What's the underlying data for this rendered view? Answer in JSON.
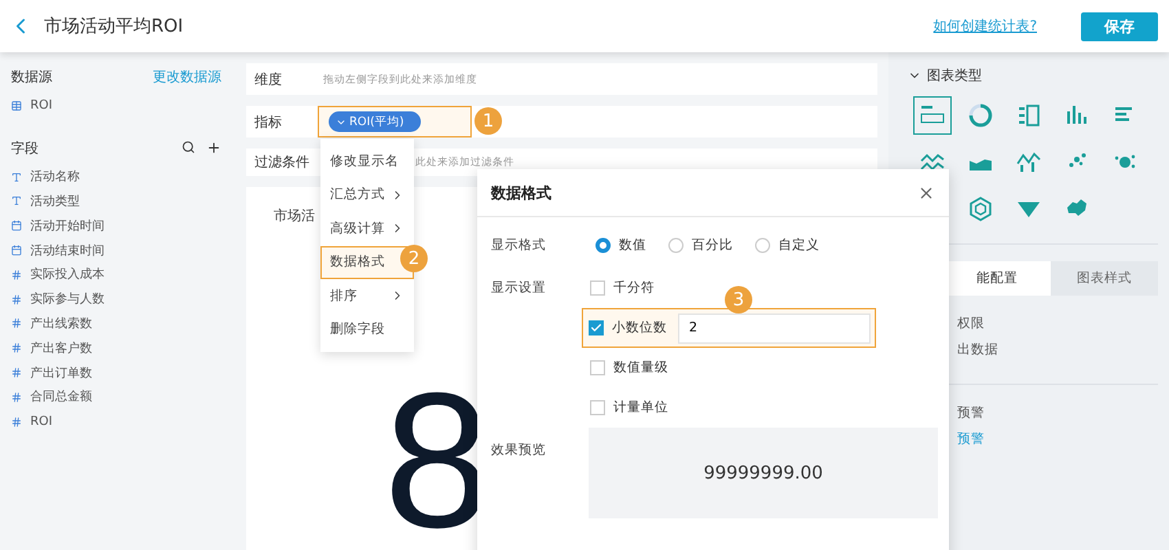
{
  "header": {
    "title": "市场活动平均ROI",
    "help_link": "如何创建统计表?",
    "save_button": "保存"
  },
  "sidebar": {
    "datasource_label": "数据源",
    "change_link": "更改数据源",
    "datasource": "ROI",
    "fields_label": "字段",
    "fields": [
      {
        "name": "活动名称",
        "kind": "text"
      },
      {
        "name": "活动类型",
        "kind": "text"
      },
      {
        "name": "活动开始时间",
        "kind": "date"
      },
      {
        "name": "活动结束时间",
        "kind": "date"
      },
      {
        "name": "实际投入成本",
        "kind": "number"
      },
      {
        "name": "实际参与人数",
        "kind": "number"
      },
      {
        "name": "产出线索数",
        "kind": "number"
      },
      {
        "name": "产出客户数",
        "kind": "number"
      },
      {
        "name": "产出订单数",
        "kind": "number"
      },
      {
        "name": "合同总金额",
        "kind": "number"
      },
      {
        "name": "ROI",
        "kind": "number"
      }
    ]
  },
  "builder": {
    "dimension": {
      "label": "维度",
      "placeholder": "拖动左侧字段到此处来添加维度"
    },
    "measure": {
      "label": "指标",
      "pill": "ROI(平均)",
      "highlighted": true,
      "step": "1"
    },
    "filter": {
      "label": "过滤条件",
      "placeholder": "此处来添加过滤条件"
    }
  },
  "card": {
    "title": "市场活",
    "value": "8"
  },
  "context_menu": {
    "step": "2",
    "items": [
      {
        "label": "修改显示名",
        "submenu": false,
        "highlighted": false
      },
      {
        "label": "汇总方式",
        "submenu": true,
        "highlighted": false
      },
      {
        "label": "高级计算",
        "submenu": true,
        "highlighted": false
      },
      {
        "label": "数据格式",
        "submenu": false,
        "highlighted": true
      },
      {
        "label": "排序",
        "submenu": true,
        "highlighted": false
      },
      {
        "label": "删除字段",
        "submenu": false,
        "highlighted": false
      }
    ]
  },
  "dialog": {
    "title": "数据格式",
    "format_label": "显示格式",
    "formats": [
      {
        "label": "数值",
        "selected": true
      },
      {
        "label": "百分比",
        "selected": false
      },
      {
        "label": "自定义",
        "selected": false
      }
    ],
    "settings_label": "显示设置",
    "step": "3",
    "settings": [
      {
        "label": "千分符",
        "checked": false,
        "highlighted": false
      },
      {
        "label": "小数位数",
        "checked": true,
        "highlighted": true,
        "value": "2"
      },
      {
        "label": "数值量级",
        "checked": false,
        "highlighted": false
      },
      {
        "label": "计量单位",
        "checked": false,
        "highlighted": false
      }
    ],
    "preview_label": "效果预览",
    "preview_value": "99999999.00"
  },
  "right_panel": {
    "section_title": "图表类型",
    "tabs": [
      {
        "label": "能配置",
        "selected": true
      },
      {
        "label": "图表样式",
        "selected": false
      }
    ],
    "permission_title": "权限",
    "export_option": "出数据",
    "alert_title": "预警",
    "alert_link": "预警"
  }
}
